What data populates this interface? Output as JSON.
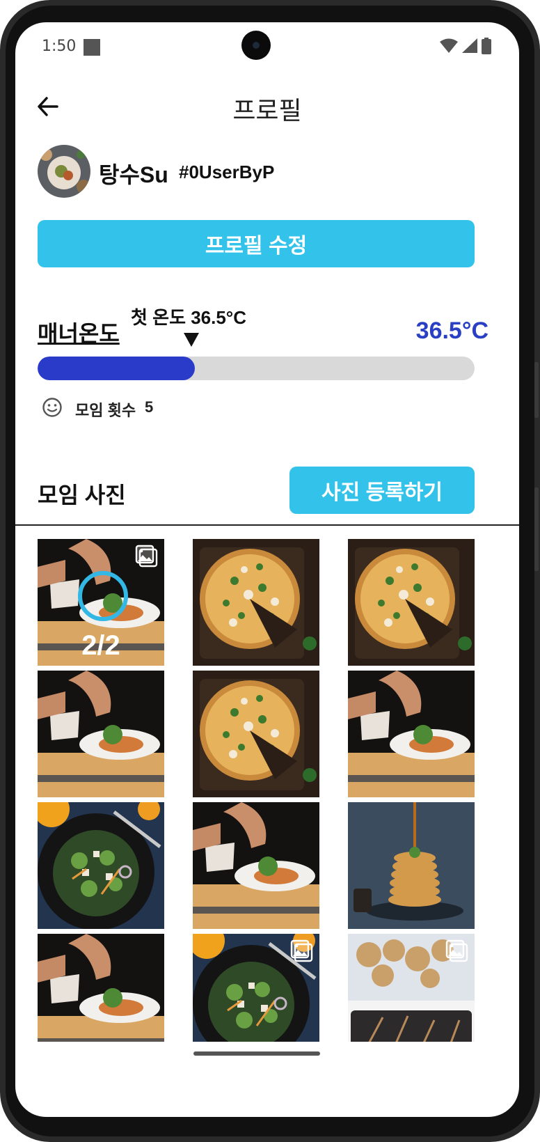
{
  "status_bar": {
    "time": "1:50"
  },
  "header": {
    "title": "프로필"
  },
  "profile": {
    "nickname": "탕수Su",
    "user_tag": "#0UserByP",
    "edit_button": "프로필 수정"
  },
  "manner": {
    "label": "매너온도",
    "first_temp_label": "첫 온도 36.5°C",
    "value_text": "36.5°C",
    "progress_fraction": 0.36
  },
  "meetings": {
    "label": "모임 횟수",
    "count": "5"
  },
  "photos": {
    "title": "모임 사진",
    "register_button": "사진 등록하기",
    "first_counter": "2/2",
    "items": [
      {
        "subject": "chef-plating",
        "multi": true,
        "selected": true
      },
      {
        "subject": "pizza",
        "multi": false
      },
      {
        "subject": "pizza",
        "multi": false
      },
      {
        "subject": "chef-plating",
        "multi": false
      },
      {
        "subject": "pizza",
        "multi": false
      },
      {
        "subject": "chef-plating",
        "multi": false
      },
      {
        "subject": "salad",
        "multi": false
      },
      {
        "subject": "chef-plating",
        "multi": false
      },
      {
        "subject": "pancakes",
        "multi": false
      },
      {
        "subject": "chef-plating",
        "multi": false
      },
      {
        "subject": "salad",
        "multi": true
      },
      {
        "subject": "fried-food",
        "multi": true
      }
    ]
  },
  "colors": {
    "accent": "#33c3ea",
    "temperature": "#2a3bc9",
    "bar_track": "#d9d9d9"
  }
}
